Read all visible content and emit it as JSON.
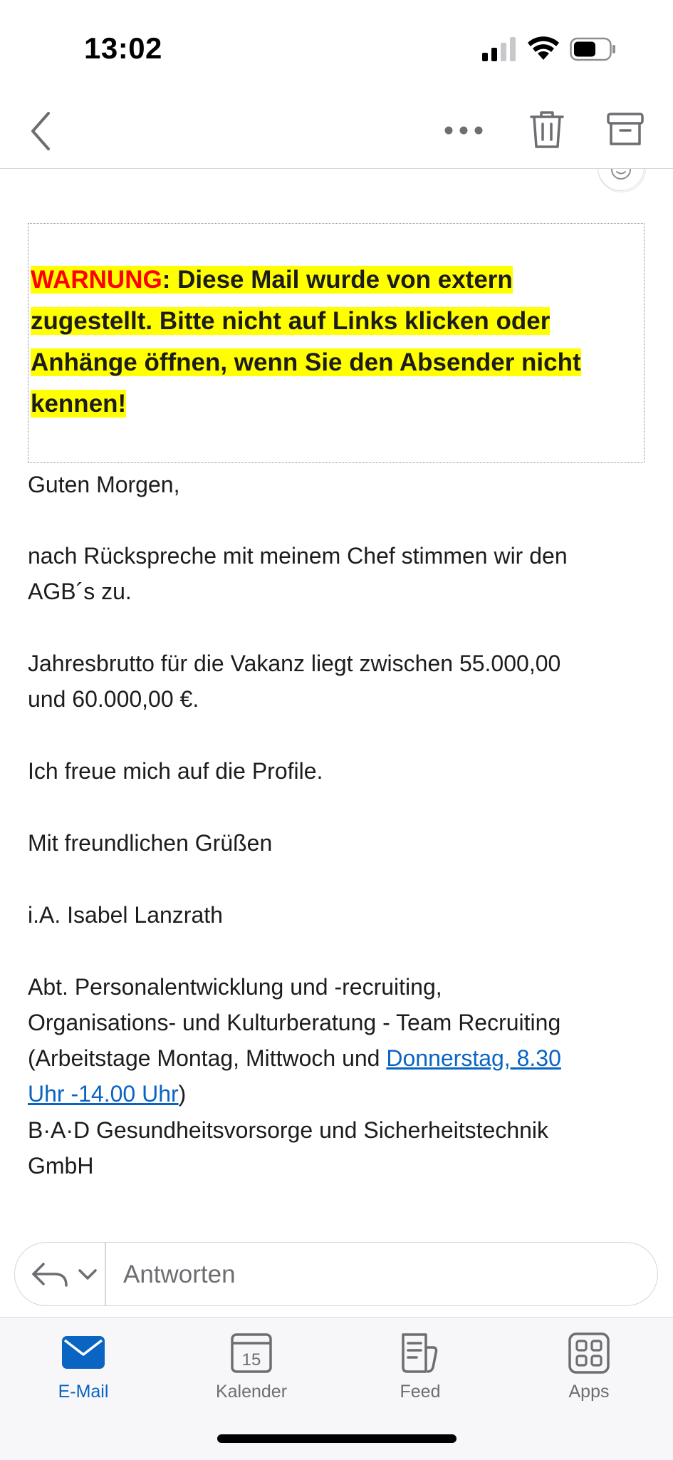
{
  "status_bar": {
    "time": "13:02"
  },
  "toolbar": {
    "back": "chevron-left-icon",
    "more": "more-horizontal-icon",
    "delete": "trash-icon",
    "archive": "archive-icon"
  },
  "colors": {
    "accent": "#0a64c2",
    "highlight": "#ffff00",
    "warning_red": "#ff0000"
  },
  "warning": {
    "label": "WARNUNG",
    "text_line1": ": Diese Mail wurde von extern",
    "text_line2": "zugestellt. Bitte nicht auf Links klicken oder",
    "text_line3": "Anhänge öffnen, wenn Sie den Absender nicht",
    "text_line4": "kennen!"
  },
  "message": {
    "greeting": "Guten Morgen,",
    "para1_line1": "nach Rückspreche mit meinem Chef stimmen wir den",
    "para1_line2": "AGB´s zu.",
    "para2_line1": "Jahresbrutto für die Vakanz liegt zwischen 55.000,00",
    "para2_line2": "und 60.000,00 €.",
    "para3": "Ich freue mich auf die Profile.",
    "closing": "Mit freundlichen Grüßen",
    "signature_name": "i.A. Isabel Lanzrath",
    "dept_line1": "Abt. Personalentwicklung und -recruiting,",
    "dept_line2": "Organisations- und Kulturberatung  - Team Recruiting",
    "dept_line3_prefix": "(Arbeitstage Montag, Mittwoch und ",
    "dept_link_part1": "Donnerstag, 8.30",
    "dept_link_part2": "Uhr -14.00 Uhr",
    "dept_line4_suffix": ")",
    "company_line1": "B·A·D Gesundheitsvorsorge und Sicherheitstechnik",
    "company_line2": "GmbH"
  },
  "reply": {
    "placeholder": "Antworten"
  },
  "tabs": [
    {
      "label": "E-Mail",
      "icon": "mail-icon",
      "active": true
    },
    {
      "label": "Kalender",
      "icon": "calendar-icon",
      "calendar_day": "15",
      "active": false
    },
    {
      "label": "Feed",
      "icon": "feed-icon",
      "active": false
    },
    {
      "label": "Apps",
      "icon": "apps-grid-icon",
      "active": false
    }
  ]
}
